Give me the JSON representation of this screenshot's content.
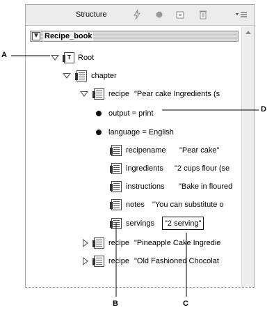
{
  "panel": {
    "title": "Structure",
    "toolbar_icons": [
      "lightning-icon",
      "circle-icon",
      "window-icon",
      "trash-icon",
      "menu-icon"
    ]
  },
  "tree": {
    "book_label": "Recipe_book",
    "root_label": "Root",
    "root_icon_text": "T",
    "chapter_label": "chapter",
    "recipe1_label": "recipe",
    "recipe1_text": "\"Pear cake Ingredients (s",
    "attr_output": "output = print",
    "attr_language": "language = English",
    "children": [
      {
        "name": "recipename",
        "text": "\"Pear cake\""
      },
      {
        "name": "ingredients",
        "text": "\"2 cups flour (se"
      },
      {
        "name": "instructions",
        "text": "\"Bake in floured"
      },
      {
        "name": "notes",
        "text": "\"You can substitute o"
      },
      {
        "name": "servings",
        "text": "\"2 serving\""
      }
    ],
    "recipe2_label": "recipe",
    "recipe2_text": "\"Pineapple Cake Ingredie",
    "recipe3_label": "recipe",
    "recipe3_text": "\"Old Fashioned Chocolat"
  },
  "callouts": {
    "a": "A",
    "b": "B",
    "c": "C",
    "d": "D"
  }
}
